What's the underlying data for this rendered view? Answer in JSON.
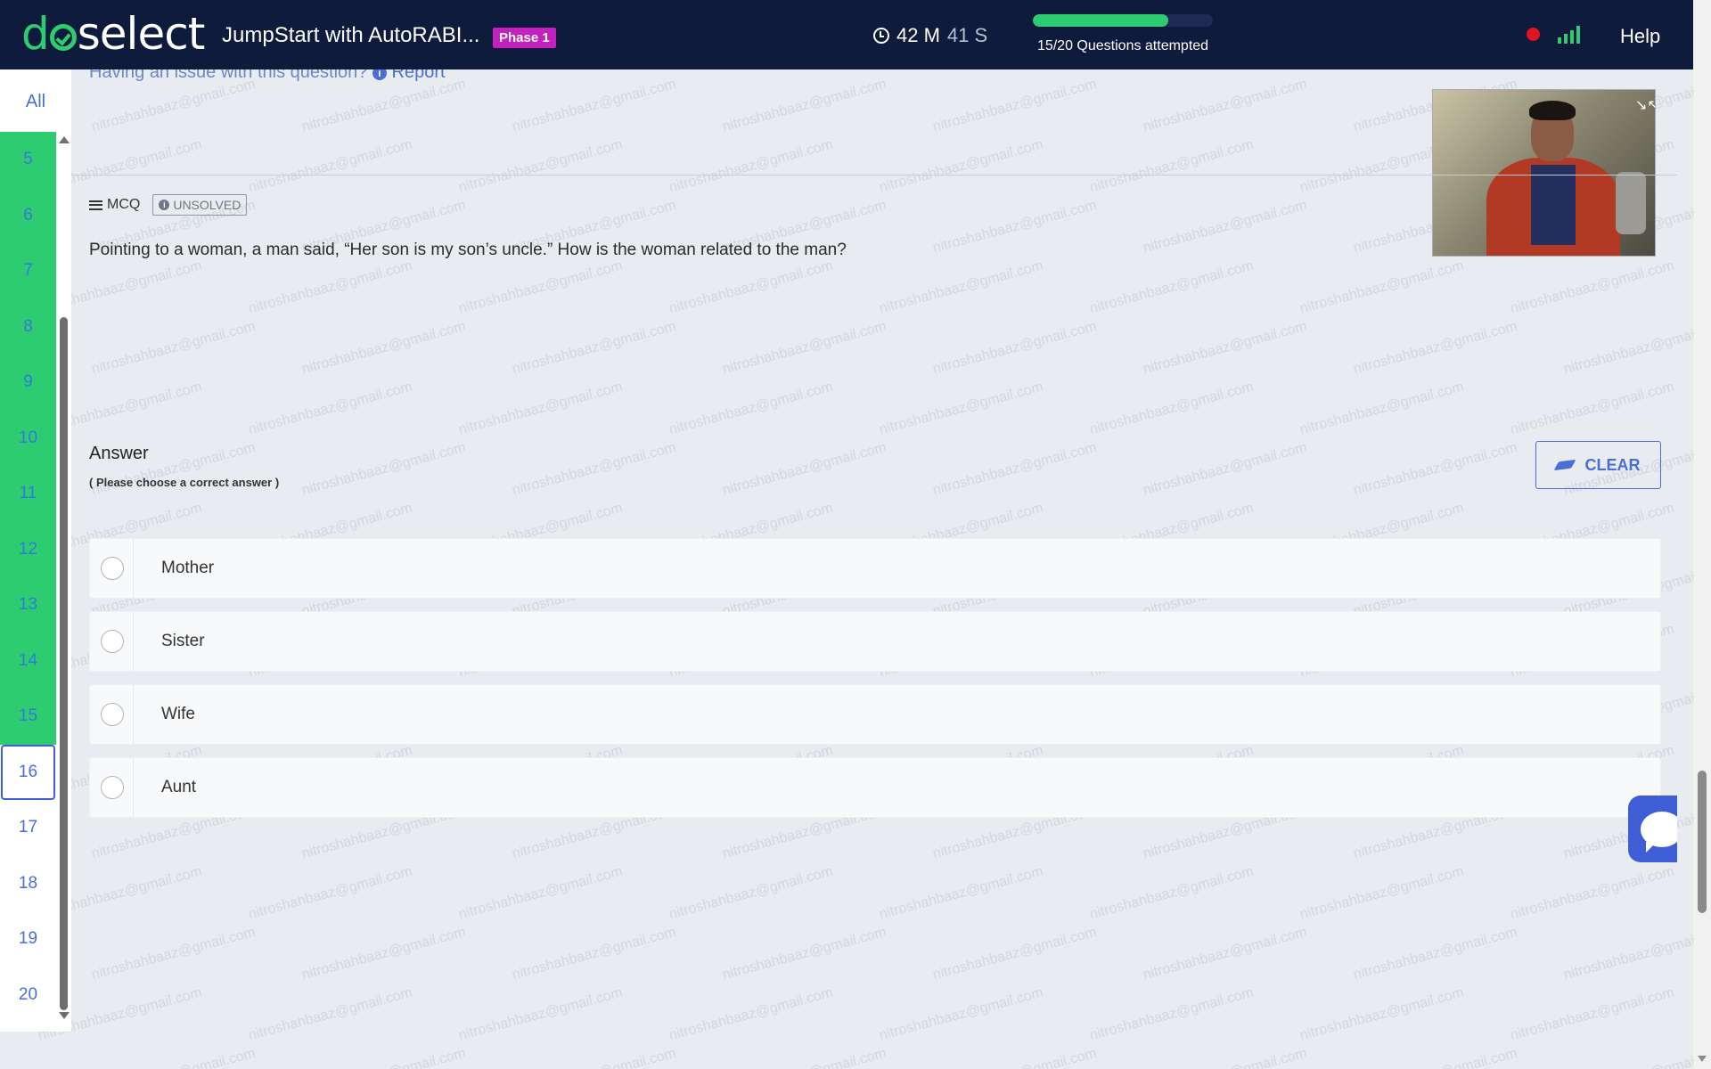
{
  "header": {
    "logo": {
      "part1": "d",
      "part2": "select"
    },
    "title": "JumpStart with AutoRABI...",
    "phase_badge": "Phase 1",
    "timer": {
      "minutes": "42 M",
      "seconds": "41 S"
    },
    "progress": {
      "attempted": 15,
      "total": 20,
      "text": "15/20 Questions attempted"
    },
    "help_label": "Help"
  },
  "sidebar": {
    "all_label": "All",
    "questions": [
      {
        "num": "5",
        "state": "done"
      },
      {
        "num": "6",
        "state": "done"
      },
      {
        "num": "7",
        "state": "done"
      },
      {
        "num": "8",
        "state": "done"
      },
      {
        "num": "9",
        "state": "done"
      },
      {
        "num": "10",
        "state": "done"
      },
      {
        "num": "11",
        "state": "done"
      },
      {
        "num": "12",
        "state": "done"
      },
      {
        "num": "13",
        "state": "done"
      },
      {
        "num": "14",
        "state": "done"
      },
      {
        "num": "15",
        "state": "done"
      },
      {
        "num": "16",
        "state": "current"
      },
      {
        "num": "17",
        "state": "pending"
      },
      {
        "num": "18",
        "state": "pending"
      },
      {
        "num": "19",
        "state": "pending"
      },
      {
        "num": "20",
        "state": "pending"
      }
    ]
  },
  "question": {
    "issue_text": "Having an issue with this question?",
    "report_label": "Report",
    "type_label": "MCQ",
    "status_label": "UNSOLVED",
    "text": "Pointing to a woman, a man said, “Her son is my son’s uncle.” How is the woman related to the man?"
  },
  "answer": {
    "label": "Answer",
    "hint": "( Please choose a correct answer )",
    "clear_label": "CLEAR",
    "options": [
      "Mother",
      "Sister",
      "Wife",
      "Aunt"
    ]
  },
  "watermark": "nitroshahbaaz@gmail.com",
  "colors": {
    "header_bg": "#0f1b3d",
    "accent_green": "#2ecc71",
    "accent_blue": "#4a6ed8",
    "phase_badge": "#c41fbf",
    "recording": "#e0151f"
  },
  "icons": [
    "clock-icon",
    "signal-icon",
    "info-icon",
    "list-icon",
    "eraser-icon",
    "chat-icon",
    "collapse-icon"
  ]
}
